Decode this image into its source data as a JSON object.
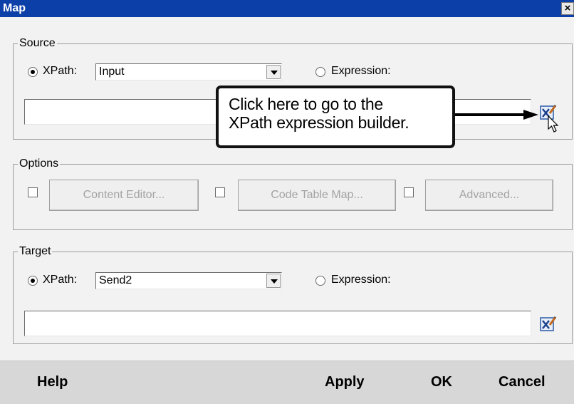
{
  "window": {
    "title": "Map",
    "close_glyph": "×"
  },
  "source": {
    "legend": "Source",
    "xpath_label": "XPath:",
    "xpath_value": "Input",
    "expression_label": "Expression:",
    "xpath_selected": true,
    "builder_icon": "xpath-builder-icon"
  },
  "callout": {
    "line1": "Click here to go to the",
    "line2": "XPath expression builder."
  },
  "options": {
    "legend": "Options",
    "content_editor": "Content Editor...",
    "code_table_map": "Code Table Map...",
    "advanced": "Advanced..."
  },
  "target": {
    "legend": "Target",
    "xpath_label": "XPath:",
    "xpath_value": "Send2",
    "expression_label": "Expression:",
    "xpath_selected": true,
    "builder_icon": "xpath-builder-icon"
  },
  "footer": {
    "help": "Help",
    "apply": "Apply",
    "ok": "OK",
    "cancel": "Cancel"
  },
  "colors": {
    "titlebar": "#0d3fa8",
    "dialog": "#f2f2f2",
    "footer": "#d7d7d7",
    "disabled_text": "#a3a3a3"
  }
}
